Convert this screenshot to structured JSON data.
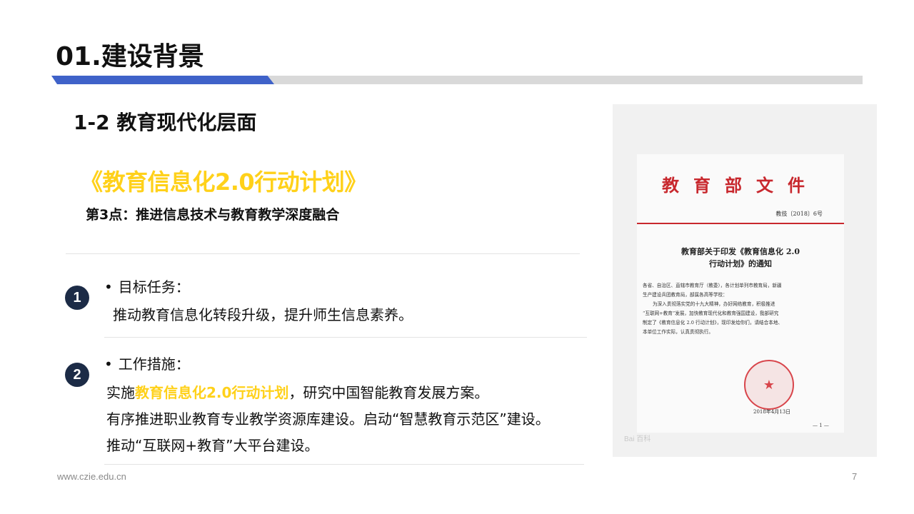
{
  "header": {
    "title": "01.建设背景",
    "accent_color": "#3f62c9"
  },
  "section": {
    "subtitle": "1-2 教育现代化层面",
    "highlight_title": "《教育信息化2.0行动计划》",
    "point": "第3点：推进信息技术与教育教学深度融合",
    "highlight_color": "#ffd11a"
  },
  "items": [
    {
      "number": "1",
      "heading": "目标任务：",
      "lines": [
        "推动教育信息化转段升级，提升师生信息素养。"
      ]
    },
    {
      "number": "2",
      "heading": "工作措施：",
      "line1_prefix": "实施",
      "line1_highlight": "教育信息化2.0行动计划",
      "line1_suffix": "，研究中国智能教育发展方案。",
      "lines": [
        "有序推进职业教育专业教学资源库建设。启动“智慧教育示范区”建设。",
        "推动“互联网+教育”大平台建设。"
      ]
    }
  ],
  "document_image": {
    "header": "教育部文件",
    "doc_number": "教技〔2018〕6号",
    "title_line1": "教育部关于印发《教育信息化 2.0",
    "title_line2": "行动计划》的通知",
    "body": [
      "各省、自治区、直辖市教育厅（教委），各计划单列市教育局，新疆",
      "生产建设兵团教育局，部属各高等学校：",
      "为深入贯彻落实党的十九大精神，办好网络教育，积极推进",
      "“互联网+教育”发展，加快教育现代化和教育强国建设，我部研究",
      "制定了《教育信息化 2.0 行动计划》，现印发给你们，请结合本地、",
      "本单位工作实际，认真贯彻执行。"
    ],
    "date": "2018年4月13日",
    "page_mark": "— 1 —",
    "seal_color": "#d8454b",
    "header_color": "#c8282e",
    "watermark": "Bai 百科"
  },
  "footer": {
    "url": "www.czie.edu.cn",
    "page_number": "7"
  }
}
